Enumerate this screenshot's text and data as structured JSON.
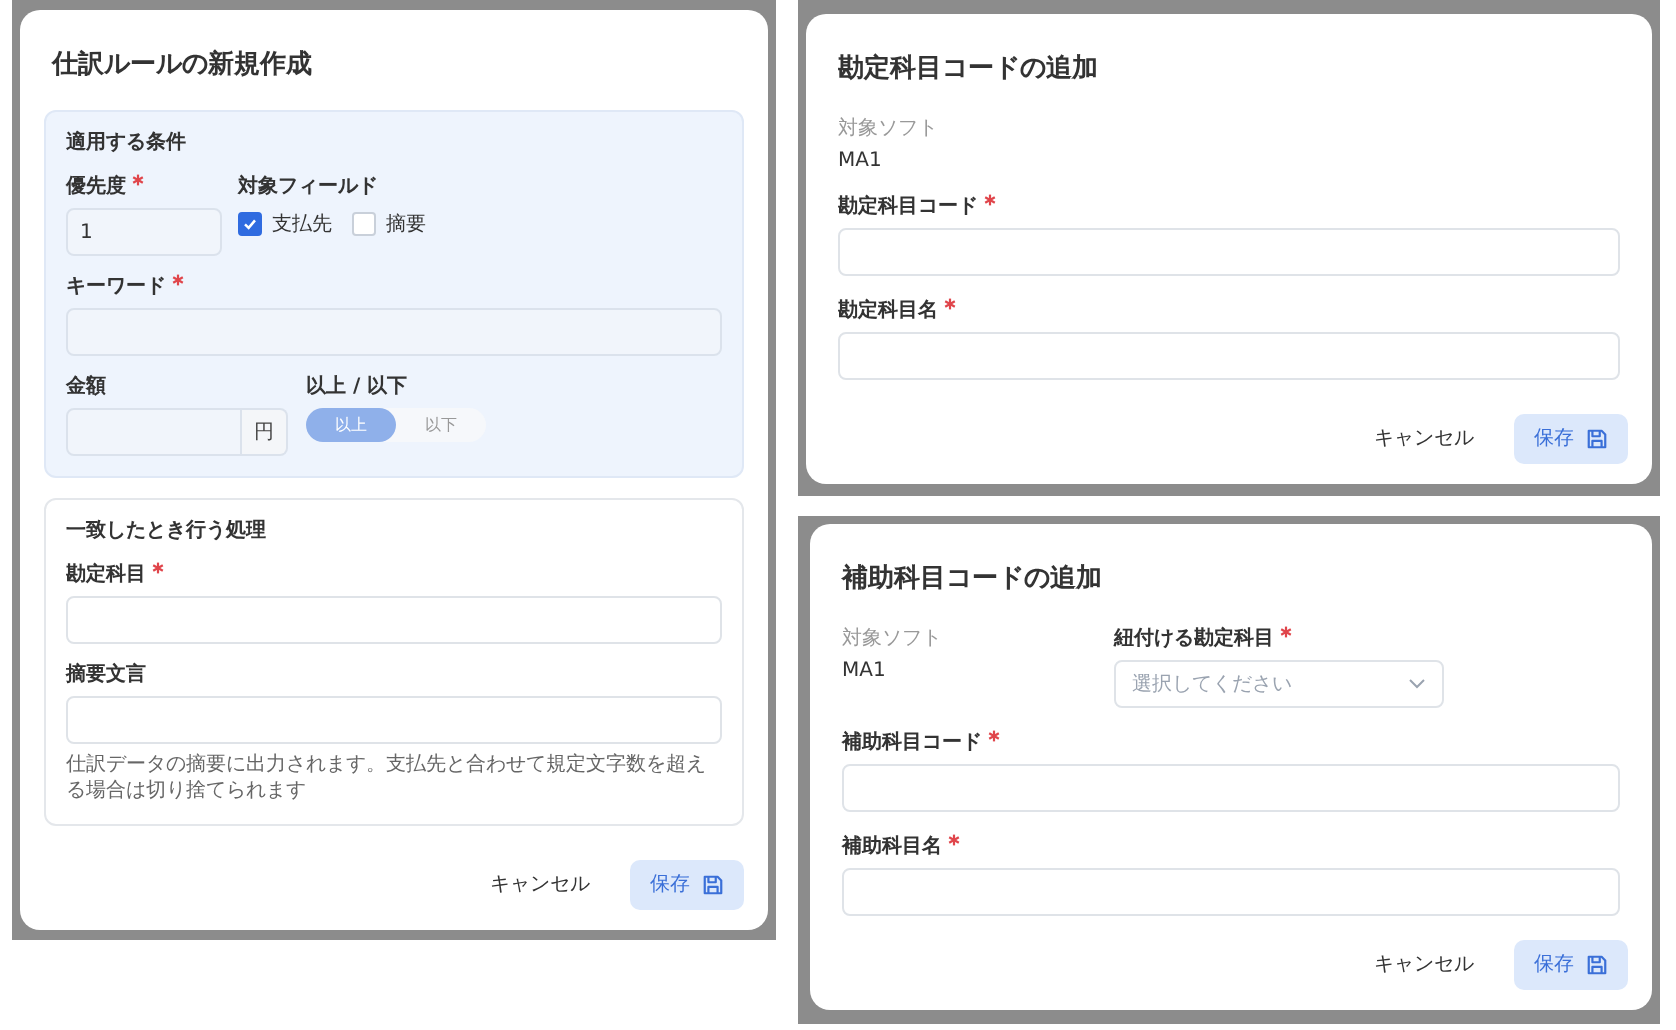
{
  "dialogs": [
    {
      "title": "仕訳ルールの新規作成",
      "sections": [
        {
          "kind": "shaded",
          "heading": "適用する条件",
          "rows": [
            {
              "fields": [
                {
                  "kind": "text",
                  "label": "優先度",
                  "required": true,
                  "value": "1"
                },
                {
                  "kind": "checks",
                  "label": "対象フィールド",
                  "required": false,
                  "options": [
                    {
                      "label": "支払先",
                      "checked": true
                    },
                    {
                      "label": "摘要",
                      "checked": false
                    }
                  ]
                }
              ]
            },
            {
              "fields": [
                {
                  "kind": "text",
                  "label": "キーワード",
                  "required": true
                }
              ]
            },
            {
              "fields": [
                {
                  "kind": "text",
                  "label": "金額",
                  "required": false,
                  "unit": "円"
                },
                {
                  "kind": "toggle",
                  "label": "以上 / 以下",
                  "required": false,
                  "options": [
                    {
                      "label": "以上",
                      "selected": true
                    },
                    {
                      "label": "以下",
                      "selected": false
                    }
                  ]
                }
              ]
            }
          ]
        },
        {
          "kind": "outlined",
          "heading": "一致したとき行う処理",
          "rows": [
            {
              "fields": [
                {
                  "kind": "text",
                  "label": "勘定科目",
                  "required": true
                }
              ]
            },
            {
              "fields": [
                {
                  "kind": "text",
                  "label": "摘要文言",
                  "required": false,
                  "help": "仕訳データの摘要に出力されます。支払先と合わせて規定文字数を超える場合は切り捨てられます"
                }
              ]
            }
          ]
        }
      ],
      "buttons": {
        "cancel": "キャンセル",
        "save": "保存"
      }
    },
    {
      "title": "勘定科目コードの追加",
      "sections": [
        {
          "kind": "plain",
          "rows": [
            {
              "fields": [
                {
                  "kind": "readonly",
                  "label": "対象ソフト",
                  "value": "MA1"
                }
              ]
            },
            {
              "fields": [
                {
                  "kind": "text",
                  "label": "勘定科目コード",
                  "required": true
                }
              ]
            },
            {
              "fields": [
                {
                  "kind": "text",
                  "label": "勘定科目名",
                  "required": true
                }
              ]
            }
          ]
        }
      ],
      "buttons": {
        "cancel": "キャンセル",
        "save": "保存"
      }
    },
    {
      "title": "補助科目コードの追加",
      "sections": [
        {
          "kind": "plain",
          "rows": [
            {
              "fields": [
                {
                  "kind": "readonly",
                  "label": "対象ソフト",
                  "value": "MA1"
                },
                {
                  "kind": "select",
                  "label": "紐付ける勘定科目",
                  "required": true,
                  "placeholder": "選択してください"
                }
              ]
            },
            {
              "fields": [
                {
                  "kind": "text",
                  "label": "補助科目コード",
                  "required": true
                }
              ]
            },
            {
              "fields": [
                {
                  "kind": "text",
                  "label": "補助科目名",
                  "required": true
                }
              ]
            }
          ]
        }
      ],
      "buttons": {
        "cancel": "キャンセル",
        "save": "保存"
      }
    }
  ]
}
